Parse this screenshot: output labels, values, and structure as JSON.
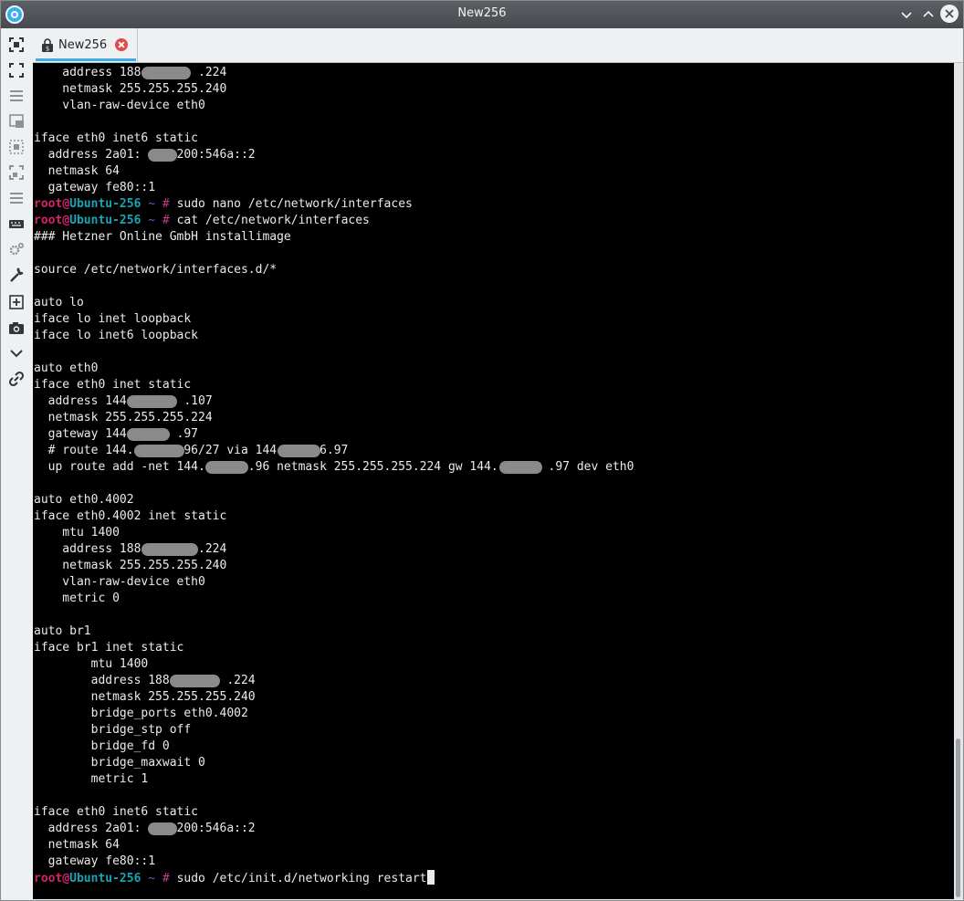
{
  "window": {
    "title": "New256"
  },
  "left_toolbar": {
    "icons": [
      "focus-icon",
      "fullscreen-icon",
      "menu-lines-icon",
      "window-panel-icon",
      "split-dashed-icon",
      "split-corner-icon",
      "list-lines-icon",
      "keyboard-icon",
      "settings-gears-icon",
      "wrench-icon",
      "new-tab-plus-icon",
      "camera-icon",
      "chevron-down-icon",
      "link-icon"
    ]
  },
  "tab": {
    "label": "New256"
  },
  "terminal": {
    "prompt": {
      "user": "root",
      "at": "@",
      "host": "Ubuntu-256",
      "tilde": "~",
      "hash": "#"
    },
    "lines": [
      {
        "kind": "text",
        "text": "    address 188        .224",
        "redactions": [
          [
            15,
            22
          ]
        ]
      },
      {
        "kind": "text",
        "text": "    netmask 255.255.255.240"
      },
      {
        "kind": "text",
        "text": "    vlan-raw-device eth0"
      },
      {
        "kind": "text",
        "text": ""
      },
      {
        "kind": "text",
        "text": "iface eth0 inet6 static"
      },
      {
        "kind": "text",
        "text": "  address 2a01:    :200:546a::2",
        "redactions": [
          [
            16,
            20
          ]
        ]
      },
      {
        "kind": "text",
        "text": "  netmask 64"
      },
      {
        "kind": "text",
        "text": "  gateway fe80::1"
      },
      {
        "kind": "prompt",
        "cmd": "sudo nano /etc/network/interfaces"
      },
      {
        "kind": "prompt",
        "cmd": "cat /etc/network/interfaces"
      },
      {
        "kind": "text",
        "text": "### Hetzner Online GmbH installimage"
      },
      {
        "kind": "text",
        "text": ""
      },
      {
        "kind": "text",
        "text": "source /etc/network/interfaces.d/*"
      },
      {
        "kind": "text",
        "text": ""
      },
      {
        "kind": "text",
        "text": "auto lo"
      },
      {
        "kind": "text",
        "text": "iface lo inet loopback"
      },
      {
        "kind": "text",
        "text": "iface lo inet6 loopback"
      },
      {
        "kind": "text",
        "text": ""
      },
      {
        "kind": "text",
        "text": "auto eth0"
      },
      {
        "kind": "text",
        "text": "iface eth0 inet static"
      },
      {
        "kind": "text",
        "text": "  address 144        .107",
        "redactions": [
          [
            13,
            20
          ]
        ]
      },
      {
        "kind": "text",
        "text": "  netmask 255.255.255.224"
      },
      {
        "kind": "text",
        "text": "  gateway 144       .97",
        "redactions": [
          [
            13,
            19
          ]
        ]
      },
      {
        "kind": "text",
        "text": "  # route 144.       96/27 via 144      6.97",
        "redactions": [
          [
            14,
            21
          ],
          [
            34,
            40
          ]
        ]
      },
      {
        "kind": "text",
        "text": "  up route add -net 144.      .96 netmask 255.255.255.224 gw 144.       .97 dev eth0",
        "redactions": [
          [
            24,
            30
          ],
          [
            65,
            71
          ]
        ]
      },
      {
        "kind": "text",
        "text": ""
      },
      {
        "kind": "text",
        "text": "auto eth0.4002"
      },
      {
        "kind": "text",
        "text": "iface eth0.4002 inet static"
      },
      {
        "kind": "text",
        "text": "    mtu 1400"
      },
      {
        "kind": "text",
        "text": "    address 188        .224",
        "redactions": [
          [
            15,
            23
          ]
        ]
      },
      {
        "kind": "text",
        "text": "    netmask 255.255.255.240"
      },
      {
        "kind": "text",
        "text": "    vlan-raw-device eth0"
      },
      {
        "kind": "text",
        "text": "    metric 0"
      },
      {
        "kind": "text",
        "text": ""
      },
      {
        "kind": "text",
        "text": "auto br1"
      },
      {
        "kind": "text",
        "text": "iface br1 inet static"
      },
      {
        "kind": "text",
        "text": "        mtu 1400"
      },
      {
        "kind": "text",
        "text": "        address 188        .224",
        "redactions": [
          [
            19,
            26
          ]
        ]
      },
      {
        "kind": "text",
        "text": "        netmask 255.255.255.240"
      },
      {
        "kind": "text",
        "text": "        bridge_ports eth0.4002"
      },
      {
        "kind": "text",
        "text": "        bridge_stp off"
      },
      {
        "kind": "text",
        "text": "        bridge_fd 0"
      },
      {
        "kind": "text",
        "text": "        bridge_maxwait 0"
      },
      {
        "kind": "text",
        "text": "        metric 1"
      },
      {
        "kind": "text",
        "text": ""
      },
      {
        "kind": "text",
        "text": "iface eth0 inet6 static"
      },
      {
        "kind": "text",
        "text": "  address 2a01:    :200:546a::2",
        "redactions": [
          [
            16,
            20
          ]
        ]
      },
      {
        "kind": "text",
        "text": "  netmask 64"
      },
      {
        "kind": "text",
        "text": "  gateway fe80::1"
      },
      {
        "kind": "prompt",
        "cmd": "sudo /etc/init.d/networking restart",
        "cursor": true
      }
    ]
  }
}
